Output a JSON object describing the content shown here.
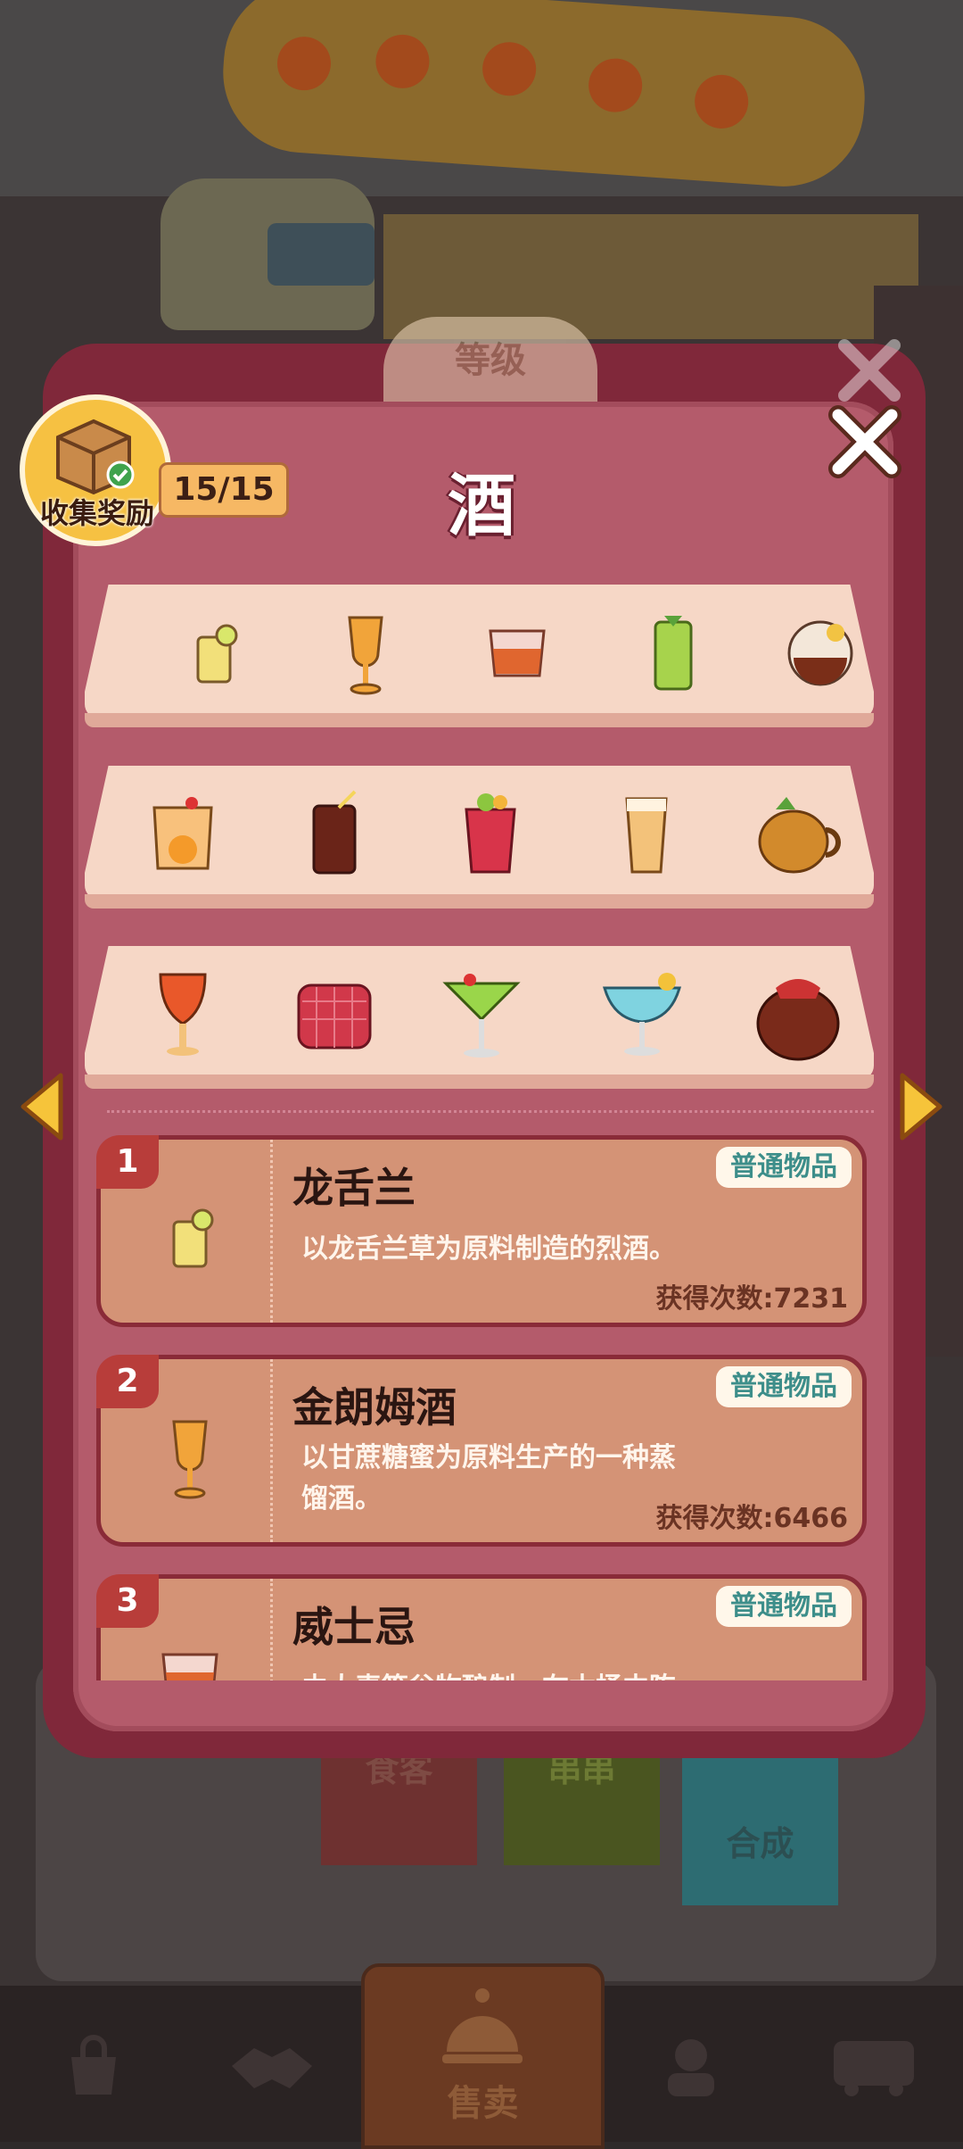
{
  "header": {
    "title": "酒",
    "reward_label": "收集奖励",
    "reward_count": "15/15",
    "level_label": "等级"
  },
  "shelves": [
    {
      "items": [
        "tequila-shot-glass-icon",
        "rum-goblet-icon",
        "whiskey-glass-icon",
        "green-cocktail-icon",
        "brandy-glass-icon"
      ]
    },
    {
      "items": [
        "orange-cocktail-icon",
        "cola-highball-icon",
        "berry-cocktail-icon",
        "beer-glass-icon",
        "tiki-mug-icon"
      ]
    },
    {
      "items": [
        "sunset-cocktail-icon",
        "red-rocks-glass-icon",
        "martini-glass-icon",
        "blue-margarita-icon",
        "wine-jar-icon"
      ]
    }
  ],
  "items": [
    {
      "num": "1",
      "name": "龙舌兰",
      "tag": "普通物品",
      "desc": "以龙舌兰草为原料制造的烈酒。",
      "count": "获得次数:7231"
    },
    {
      "num": "2",
      "name": "金朗姆酒",
      "tag": "普通物品",
      "desc": "以甘蔗糖蜜为原料生产的一种蒸馏酒。",
      "count": "获得次数:6466"
    },
    {
      "num": "3",
      "name": "威士忌",
      "tag": "普通物品",
      "desc": "由大麦等谷物酿制，在木桶中陈",
      "count": ""
    }
  ],
  "background": {
    "ribbons": [
      "食客",
      "串串",
      "合成"
    ]
  },
  "nav": {
    "active_label": "售卖",
    "items": [
      "bag-icon",
      "handshake-icon",
      "sell-bell-icon",
      "chef-icon",
      "bus-icon"
    ]
  },
  "colors": {
    "panel": "#b45b6b",
    "panel_border": "#80283a",
    "shelf": "#f6d7c6",
    "card": "#d49376",
    "tag_text": "#3d8e8a",
    "reward": "#f6c142"
  }
}
